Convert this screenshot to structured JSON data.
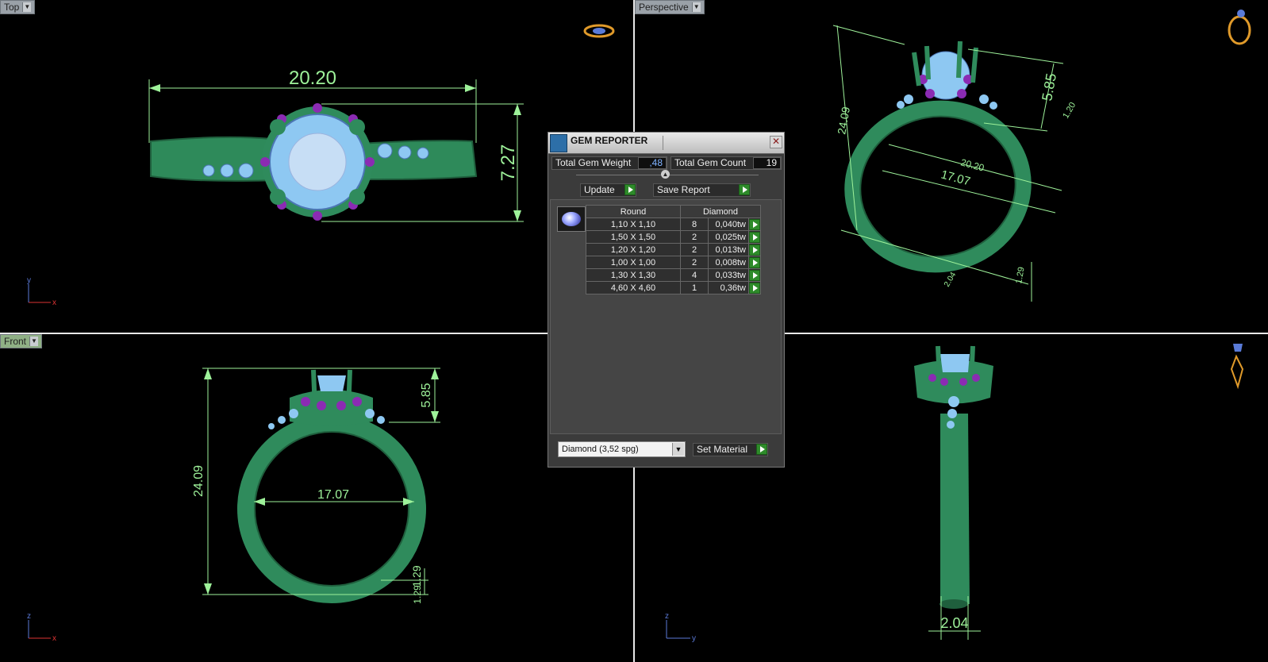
{
  "viewports": {
    "top": {
      "label": "Top",
      "axes": {
        "v": "y",
        "h": "x"
      },
      "dims": {
        "width": "20.20",
        "height": "7.27"
      }
    },
    "perspective": {
      "label": "Perspective",
      "dims": {
        "height": "24.09",
        "top": "5.85",
        "top_small": "1.20",
        "outer": "20.20",
        "inner": "17.07",
        "bottom": "1.29",
        "bottom_left": "2.04"
      }
    },
    "front": {
      "label": "Front",
      "axes": {
        "v": "z",
        "h": "x"
      },
      "dims": {
        "height": "24.09",
        "top": "5.85",
        "inner": "17.07",
        "bottom": "1.29",
        "bottom2": "1.29"
      }
    },
    "right": {
      "axes": {
        "v": "z",
        "h": "y"
      },
      "dims": {
        "bottom": "2.04"
      }
    }
  },
  "gem_reporter": {
    "title": "GEM REPORTER",
    "total_weight_label": "Total Gem Weight",
    "total_weight_value": ",48",
    "total_count_label": "Total Gem Count",
    "total_count_value": "19",
    "update_label": "Update",
    "save_label": "Save Report",
    "table": {
      "col_shape": "Round",
      "col_material": "Diamond",
      "rows": [
        {
          "size": "1,10 X 1,10",
          "count": "8",
          "weight": "0,040tw"
        },
        {
          "size": "1,50 X 1,50",
          "count": "2",
          "weight": "0,025tw"
        },
        {
          "size": "1,20 X 1,20",
          "count": "2",
          "weight": "0,013tw"
        },
        {
          "size": "1,00 X 1,00",
          "count": "2",
          "weight": "0,008tw"
        },
        {
          "size": "1,30 X 1,30",
          "count": "4",
          "weight": "0,033tw"
        },
        {
          "size": "4,60 X 4,60",
          "count": "1",
          "weight": "0,36tw"
        }
      ]
    },
    "material_select": "Diamond     (3,52 spg)",
    "set_material_label": "Set Material"
  },
  "colors": {
    "metal": "#2f8b5c",
    "gem": "#8ec8f2",
    "accent_gem": "#8b2bb3",
    "dimension": "#9ef29a"
  }
}
